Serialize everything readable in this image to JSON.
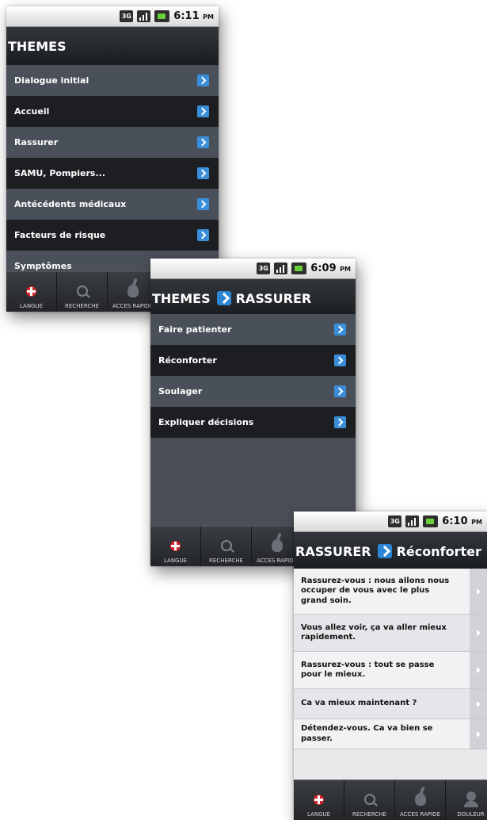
{
  "screen1": {
    "status_time": "6:11",
    "status_ampm": "PM",
    "net": "3G",
    "title": "THEMES",
    "items": [
      "Dialogue initial",
      "Accueil",
      "Rassurer",
      "SAMU, Pompiers...",
      "Antécédents médicaux",
      "Facteurs de risque",
      "Symptômes"
    ],
    "tabs": [
      "LANGUE",
      "RECHERCHE",
      "ACCES RAPIDE"
    ]
  },
  "screen2": {
    "status_time": "6:09",
    "status_ampm": "PM",
    "net": "3G",
    "title_part1": "THEMES",
    "title_part2": "RASSURER",
    "items": [
      "Faire patienter",
      "Réconforter",
      "Soulager",
      "Expliquer décisions"
    ],
    "tabs": [
      "LANGUE",
      "RECHERCHE",
      "ACCES RAPIDE"
    ]
  },
  "screen3": {
    "status_time": "6:10",
    "status_ampm": "PM",
    "net": "3G",
    "title_part1": "RASSURER",
    "title_part2": "Réconforter",
    "items": [
      "Rassurez-vous : nous allons nous occuper de vous avec le plus grand soin.",
      "Vous allez voir, ça va aller mieux rapidement.",
      "Rassurez-vous : tout se passe pour le mieux.",
      "Ca va mieux maintenant ?",
      "Détendez-vous. Ca va bien se passer."
    ],
    "tabs": [
      "LANGUE",
      "RECHERCHE",
      "ACCES RAPIDE",
      "DOULEUR"
    ]
  },
  "colors": {
    "accent": "#2b86d6",
    "row_light": "#4a5059",
    "row_dark": "#1c1e22"
  }
}
